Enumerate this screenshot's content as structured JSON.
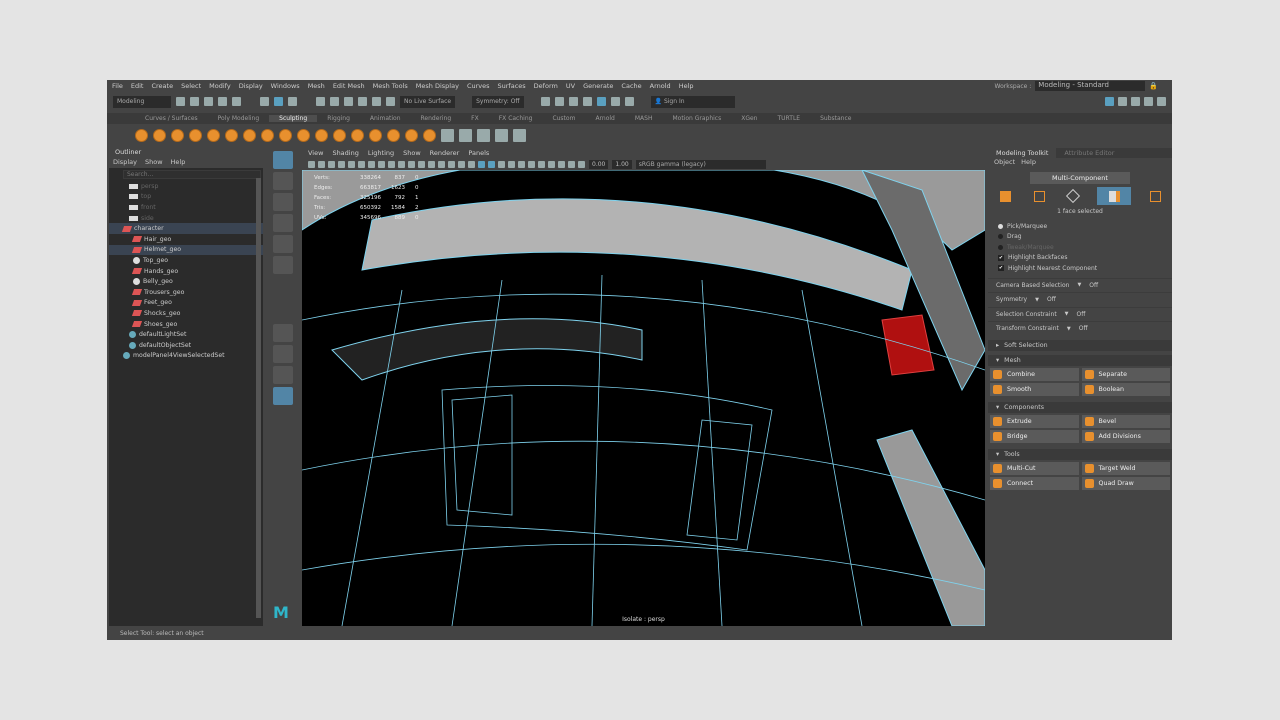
{
  "menubar": [
    "File",
    "Edit",
    "Create",
    "Select",
    "Modify",
    "Display",
    "Windows",
    "Mesh",
    "Edit Mesh",
    "Mesh Tools",
    "Mesh Display",
    "Curves",
    "Surfaces",
    "Deform",
    "UV",
    "Generate",
    "Cache",
    "Arnold",
    "Help"
  ],
  "workspace": {
    "label": "Workspace :",
    "value": "Modeling - Standard"
  },
  "statusline": {
    "menuset": "Modeling",
    "live_surface": "No Live Surface",
    "symmetry": "Symmetry: Off",
    "sign_in": "Sign In"
  },
  "shelf_tabs": [
    "Curves / Surfaces",
    "Poly Modeling",
    "Sculpting",
    "Rigging",
    "Animation",
    "Rendering",
    "FX",
    "FX Caching",
    "Custom",
    "Arnold",
    "MASH",
    "Motion Graphics",
    "XGen",
    "TURTLE",
    "Substance"
  ],
  "outliner": {
    "title": "Outliner",
    "menu": [
      "Display",
      "Show",
      "Help"
    ],
    "search_placeholder": "Search...",
    "items": [
      {
        "label": "persp",
        "type": "cam"
      },
      {
        "label": "top",
        "type": "cam"
      },
      {
        "label": "front",
        "type": "cam"
      },
      {
        "label": "side",
        "type": "cam"
      },
      {
        "label": "character",
        "type": "geo"
      },
      {
        "label": "Hair_geo",
        "type": "geo"
      },
      {
        "label": "Helmet_geo",
        "type": "geo"
      },
      {
        "label": "Top_geo",
        "type": "grp"
      },
      {
        "label": "Hands_geo",
        "type": "geo"
      },
      {
        "label": "Belly_geo",
        "type": "grp"
      },
      {
        "label": "Trousers_geo",
        "type": "geo"
      },
      {
        "label": "Feet_geo",
        "type": "geo"
      },
      {
        "label": "Shocks_geo",
        "type": "geo"
      },
      {
        "label": "Shoes_geo",
        "type": "geo"
      },
      {
        "label": "defaultLightSet",
        "type": "set"
      },
      {
        "label": "defaultObjectSet",
        "type": "set"
      },
      {
        "label": "modelPanel4ViewSelectedSet",
        "type": "set"
      }
    ]
  },
  "viewport": {
    "menu": [
      "View",
      "Shading",
      "Lighting",
      "Show",
      "Renderer",
      "Panels"
    ],
    "exposure": "0.00",
    "gamma": "1.00",
    "color_space": "sRGB gamma (legacy)",
    "isolate": "Isolate : persp",
    "hud": [
      [
        "Verts:",
        "338264",
        "837",
        "0"
      ],
      [
        "Edges:",
        "663817",
        "1623",
        "0"
      ],
      [
        "Faces:",
        "325196",
        "792",
        "1"
      ],
      [
        "Tris:",
        "650392",
        "1584",
        "2"
      ],
      [
        "UVs:",
        "345696",
        "889",
        "0"
      ]
    ]
  },
  "right_panel": {
    "tabs": [
      "Modeling Toolkit",
      "Attribute Editor"
    ],
    "menu": [
      "Object",
      "Help"
    ],
    "multi_component": "Multi-Component",
    "selection_info": "1 face selected",
    "options": [
      {
        "label": "Pick/Marquee",
        "kind": "radio",
        "on": true
      },
      {
        "label": "Drag",
        "kind": "radio",
        "on": false
      },
      {
        "label": "Tweak/Marquee",
        "kind": "radio",
        "on": false,
        "disabled": true
      },
      {
        "label": "Highlight Backfaces",
        "kind": "check",
        "on": true
      },
      {
        "label": "Highlight Nearest Component",
        "kind": "check",
        "on": true
      }
    ],
    "props": [
      {
        "label": "Camera Based Selection",
        "value": "Off"
      },
      {
        "label": "Symmetry",
        "value": "Off"
      },
      {
        "label": "Selection Constraint",
        "value": "Off"
      },
      {
        "label": "Transform Constraint",
        "value": "Off"
      }
    ],
    "soft_selection": "Soft Selection",
    "sections": [
      {
        "title": "Mesh",
        "buttons": [
          "Combine",
          "Separate",
          "Smooth",
          "Boolean"
        ]
      },
      {
        "title": "Components",
        "buttons": [
          "Extrude",
          "Bevel",
          "Bridge",
          "Add Divisions"
        ]
      },
      {
        "title": "Tools",
        "buttons": [
          "Multi-Cut",
          "Target Weld",
          "Connect",
          "Quad Draw"
        ]
      }
    ]
  },
  "status_bar": "Select Tool: select an object",
  "colors": {
    "accent": "#5285a6",
    "wire": "#7fd3ee",
    "selected_face": "#b01010",
    "icon_orange": "#e8902e"
  }
}
